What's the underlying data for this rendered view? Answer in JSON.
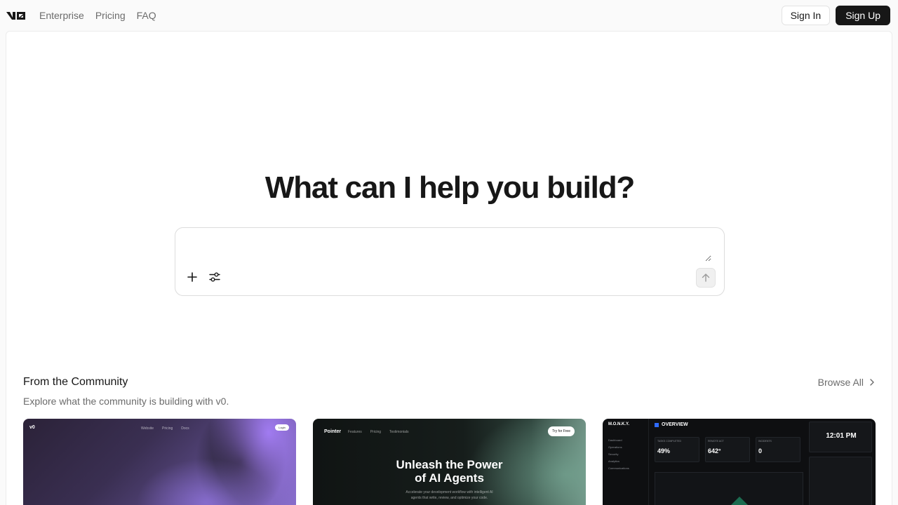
{
  "brand": {
    "logo_text": "v0"
  },
  "nav": {
    "links": [
      "Enterprise",
      "Pricing",
      "FAQ"
    ]
  },
  "auth": {
    "sign_in": "Sign In",
    "sign_up": "Sign Up"
  },
  "hero": {
    "title": "What can I help you build?",
    "prompt_placeholder": ""
  },
  "community": {
    "title": "From the Community",
    "subtitle": "Explore what the community is building with v0.",
    "browse_all": "Browse All",
    "cards": [
      {
        "nav": [
          "Website",
          "Pricing",
          "Docs"
        ],
        "cta": "Login"
      },
      {
        "brand": "Pointer",
        "nav": [
          "Features",
          "Pricing",
          "Testimonials"
        ],
        "cta": "Try for Free",
        "headline_1": "Unleash the Power",
        "headline_2": "of AI Agents",
        "sub_1": "Accelerate your development workflow with intelligent AI",
        "sub_2": "agents that write, review, and optimize your code."
      },
      {
        "brand": "M.O.N.K.Y.",
        "title": "OVERVIEW",
        "side_items": [
          "Dashboard",
          "Operations",
          "Security",
          "Analytics",
          "Communications"
        ],
        "stats": [
          {
            "label": "TASKS COMPLETED",
            "value": "49%"
          },
          {
            "label": "REMOTE ACT",
            "value": "642°"
          },
          {
            "label": "INCIDENTS",
            "value": "0"
          }
        ],
        "clock": "12:01 PM"
      }
    ]
  },
  "colors": {
    "primary": "#171717",
    "muted": "#6b6b6b",
    "border": "#dcdcdc",
    "accent_blue": "#2f6bff"
  }
}
